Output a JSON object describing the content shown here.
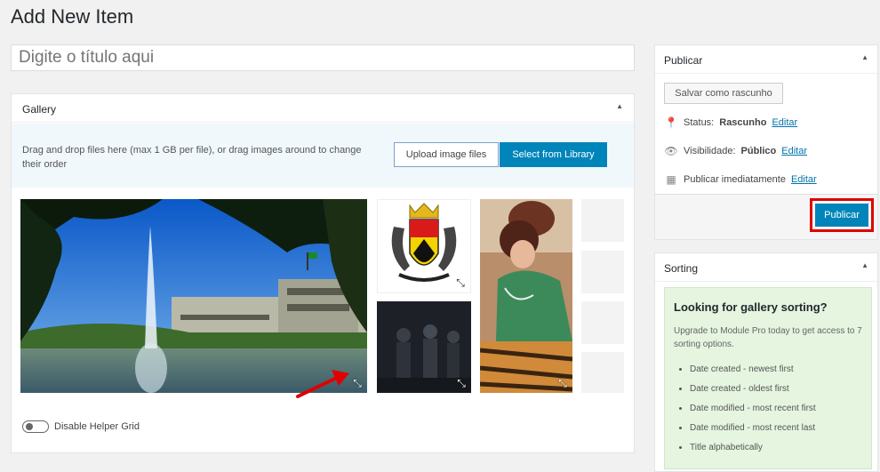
{
  "page_title": "Add New Item",
  "title_placeholder": "Digite o título aqui",
  "gallery": {
    "title": "Gallery",
    "upload_text": "Drag and drop files here (max 1 GB per file), or drag images around to change their order",
    "upload_button": "Upload image files",
    "library_button": "Select from Library",
    "helper_grid_label": "Disable Helper Grid"
  },
  "publish": {
    "title": "Publicar",
    "save_draft": "Salvar como rascunho",
    "status_label": "Status:",
    "status_value": "Rascunho",
    "visibility_label": "Visibilidade:",
    "visibility_value": "Público",
    "schedule_label": "Publicar imediatamente",
    "edit_link": "Editar",
    "publish_button": "Publicar"
  },
  "sorting": {
    "title": "Sorting",
    "promo_title": "Looking for gallery sorting?",
    "promo_desc": "Upgrade to Module Pro today to get access to 7 sorting options.",
    "options": [
      "Date created - newest first",
      "Date created - oldest first",
      "Date modified - most recent first",
      "Date modified - most recent last",
      "Title alphabetically"
    ]
  },
  "colors": {
    "primary": "#0085ba",
    "highlight": "#e00000",
    "promo_bg": "#e5f5e0"
  }
}
